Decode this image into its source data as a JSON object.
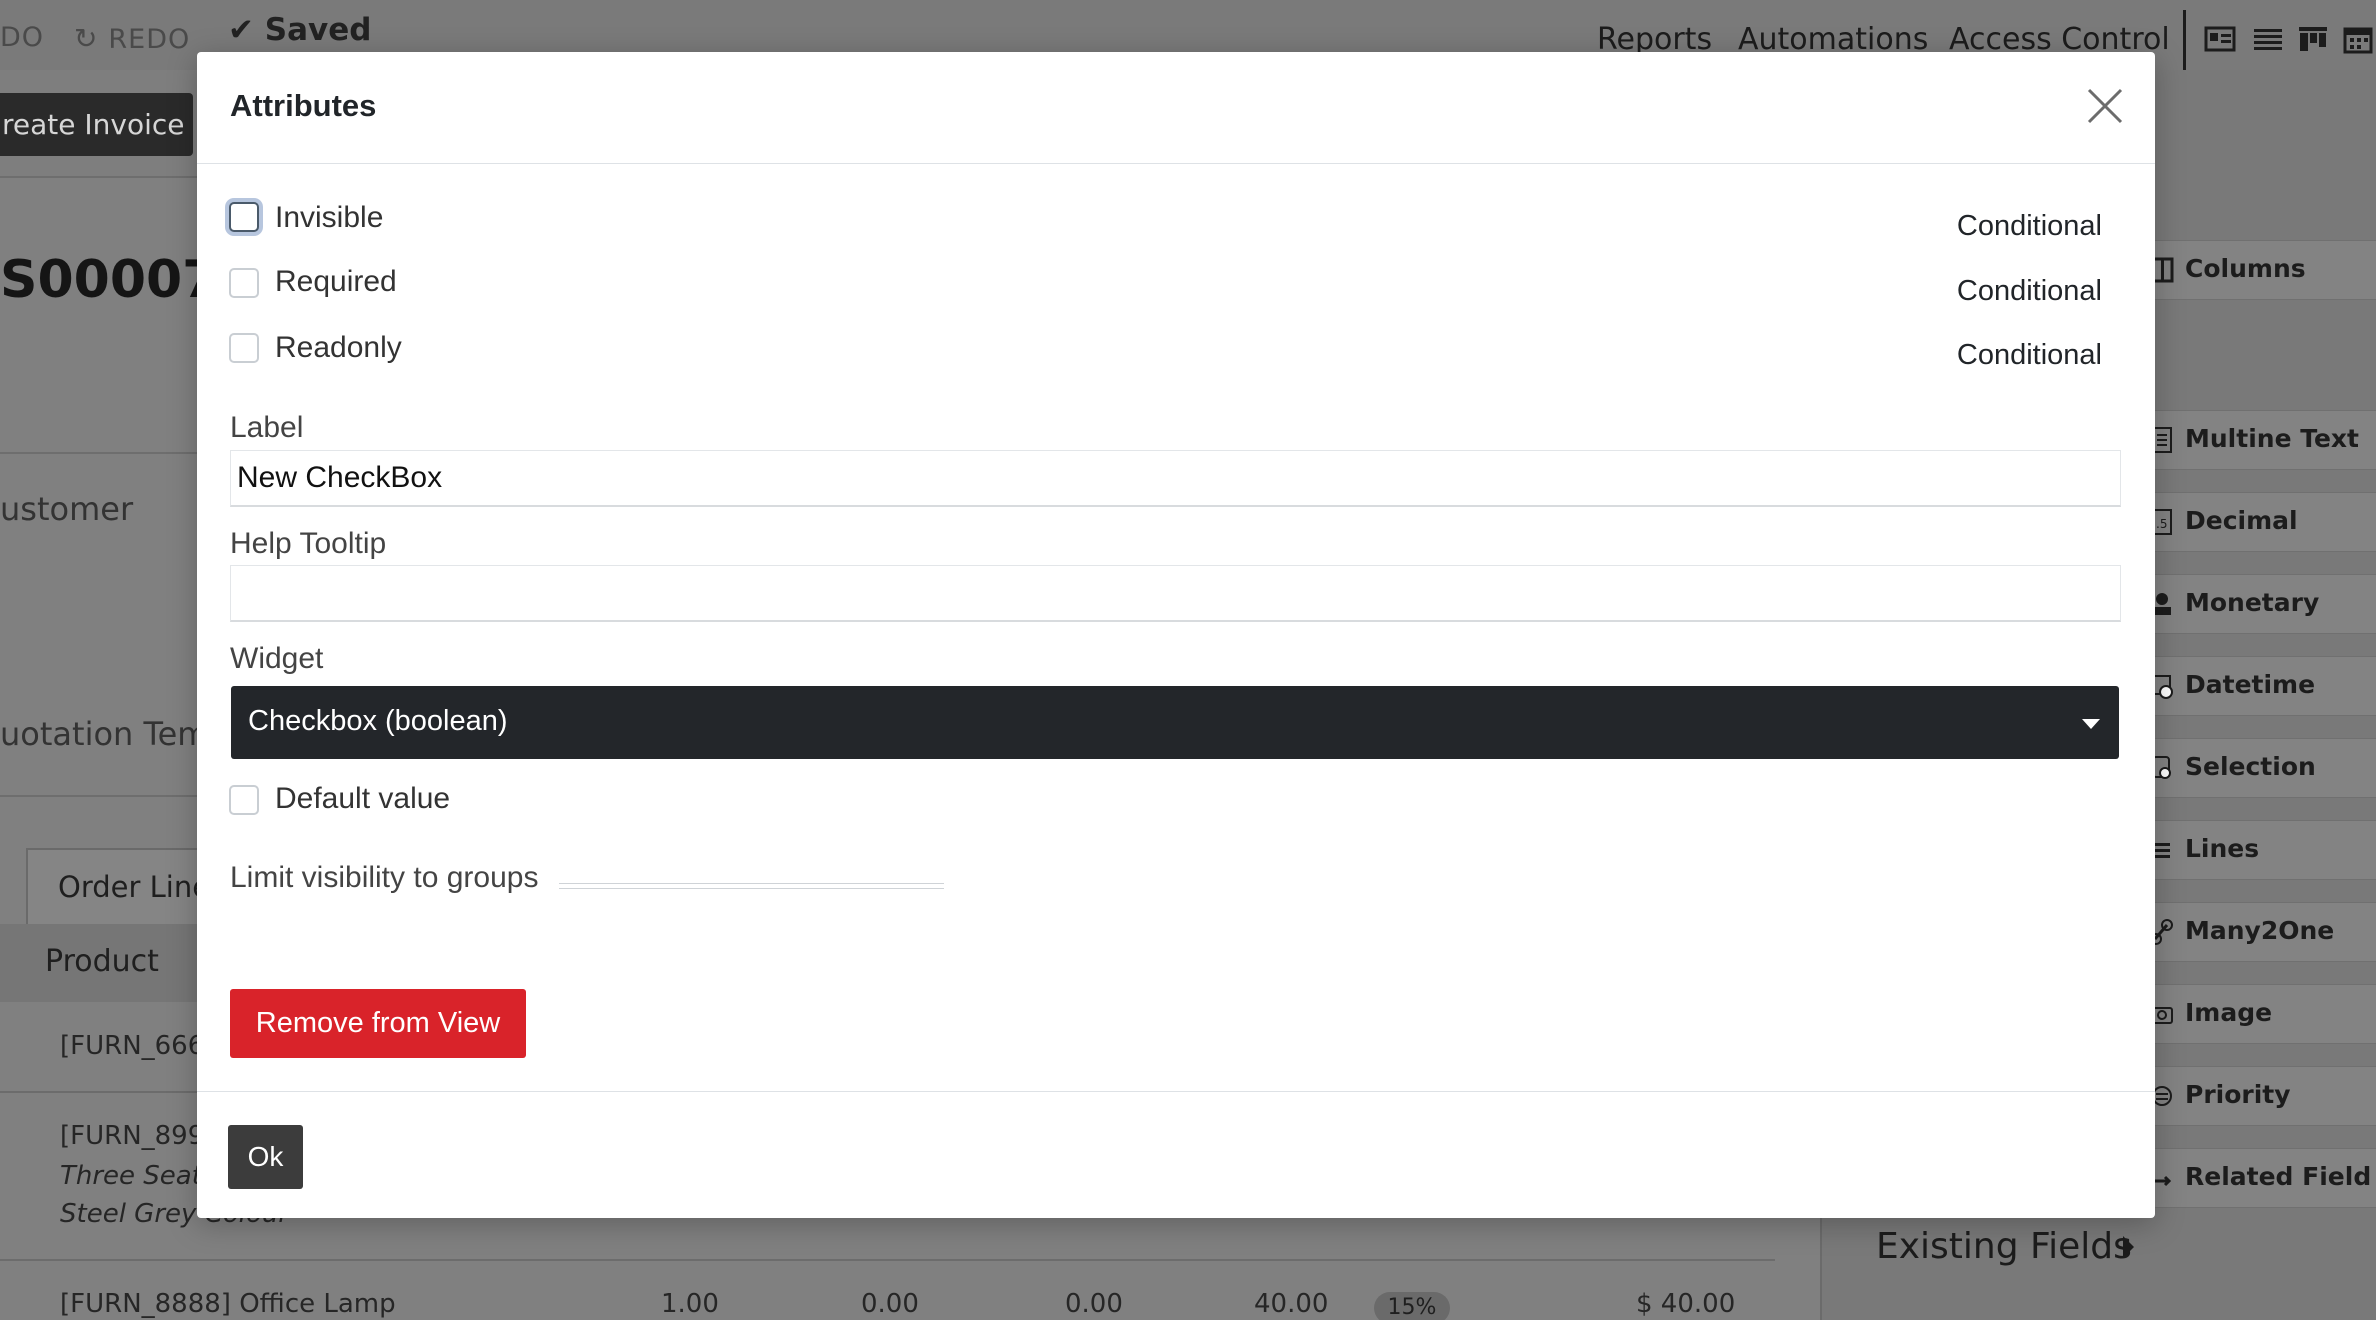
{
  "background": {
    "undo_label": "DO",
    "redo_label": "REDO",
    "saved_label": "Saved",
    "top_menu": [
      "Reports",
      "Automations",
      "Access Control"
    ],
    "create_invoice_label": "reate Invoice",
    "record_number": "S00007",
    "customer_label": "ustomer",
    "quotation_template_label": "uotation Tem",
    "tab_order_lines": "Order Line",
    "table_header_product": "Product",
    "rows": [
      {
        "line1": "[FURN_666",
        "line2": "",
        "line3": ""
      },
      {
        "line1": "[FURN_899",
        "line2": "Three Seate",
        "line3": "Steel Grey Colour"
      },
      {
        "line1": "[FURN_8888] Office Lamp",
        "qty": "1.00",
        "c1": "0.00",
        "c2": "0.00",
        "price": "40.00",
        "disc": "15%",
        "total": "$ 40.00"
      }
    ],
    "sidebar_fields": [
      "Columns",
      "Multine Text",
      "Decimal",
      "Monetary",
      "Datetime",
      "Selection",
      "Lines",
      "Many2One",
      "Image",
      "Priority",
      "Related Field"
    ],
    "existing_fields_label": "Existing Fields"
  },
  "modal": {
    "title": "Attributes",
    "invisible_label": "Invisible",
    "required_label": "Required",
    "readonly_label": "Readonly",
    "conditional_label": "Conditional",
    "label_field_label": "Label",
    "label_value": "New CheckBox",
    "help_tooltip_label": "Help Tooltip",
    "help_tooltip_value": "",
    "widget_label": "Widget",
    "widget_value": "Checkbox (boolean)",
    "default_value_label": "Default value",
    "limit_visibility_label": "Limit visibility to groups",
    "remove_button_label": "Remove from View",
    "ok_button_label": "Ok"
  }
}
